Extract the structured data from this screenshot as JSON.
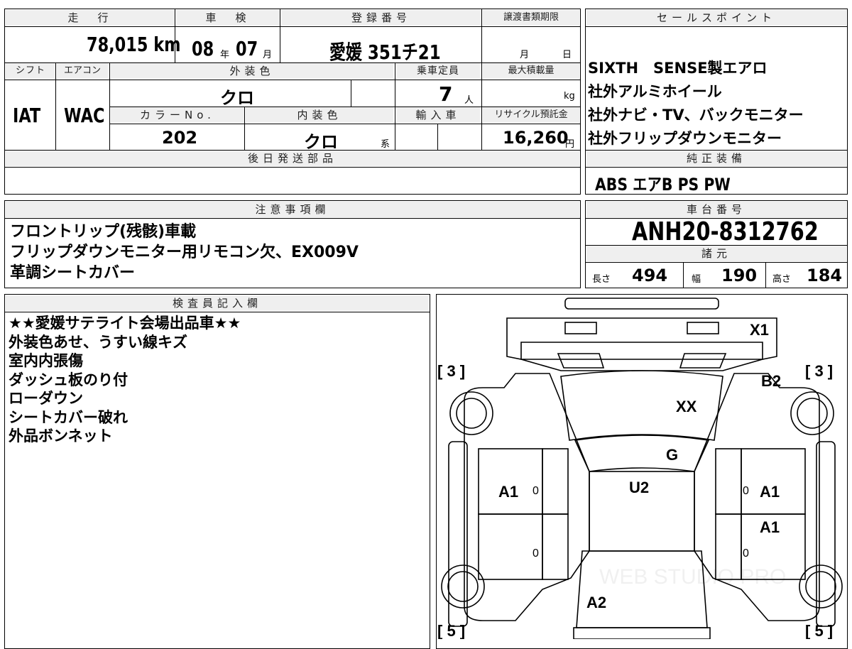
{
  "top": {
    "h_mileage": "走　行",
    "h_inspection": "車　検",
    "h_registration": "登録番号",
    "h_transfer_deadline": "譲渡書類期限",
    "mileage": "78,015 km",
    "insp_year": "08",
    "insp_year_unit": "年",
    "insp_month": "07",
    "insp_month_unit": "月",
    "registration": "愛媛 351チ21",
    "transfer_month": "月",
    "transfer_day": "日",
    "h_shift": "シフト",
    "h_aircon": "エアコン",
    "h_exterior_color": "外装色",
    "h_capacity": "乗車定員",
    "h_max_load": "最大積載量",
    "shift": "IAT",
    "aircon": "WAC",
    "exterior_color": "クロ",
    "capacity": "7",
    "capacity_unit": "人",
    "load_unit": "kg",
    "h_color_no": "カラーNo.",
    "h_interior_color": "内装色",
    "h_import": "輸入車",
    "h_recycle": "リサイクル預託金",
    "color_no": "202",
    "interior_color": "クロ",
    "interior_suffix": "系",
    "recycle_fee": "16,260",
    "recycle_unit": "円",
    "h_later_parts": "後日発送部品"
  },
  "sales": {
    "header": "セールスポイント",
    "points": [
      "SIXTH　SENSE製エアロ",
      "社外アルミホイール",
      "社外ナビ・TV、バックモニター",
      "社外フリップダウンモニター"
    ],
    "h_equipment": "純正装備",
    "equipment": "ABS エアB PS PW"
  },
  "notes": {
    "header": "注意事項欄",
    "lines": [
      "フロントリップ(残骸)車載",
      "フリップダウンモニター用リモコン欠、EX009V",
      "革調シートカバー"
    ]
  },
  "chassis": {
    "header": "車台番号",
    "number": "ANH20-8312762",
    "h_specs": "諸元",
    "length_label": "長さ",
    "length": "494",
    "width_label": "幅",
    "width": "190",
    "height_label": "高さ",
    "height": "184"
  },
  "inspector": {
    "header": "検査員記入欄",
    "lines": [
      "★★愛媛サテライト会場出品車★★",
      "外装色あせ、うすい線キズ",
      "室内内張傷",
      "ダッシュ板のり付",
      "ローダウン",
      "シートカバー破れ",
      "外品ボンネット"
    ]
  },
  "diagram": {
    "tire_fl": "[ 3 ]",
    "tire_fr": "[ 3 ]",
    "tire_rl": "[ 5 ]",
    "tire_rr": "[ 5 ]",
    "mark_x1": "X1",
    "mark_b2": "B2",
    "mark_xx": "XX",
    "mark_g": "G",
    "mark_u2": "U2",
    "mark_a1_left": "A1",
    "mark_a1_right_front": "A1",
    "mark_a1_right_rear": "A1",
    "mark_a2": "A2",
    "zero": "0",
    "watermark": "WEB STUDIO PRO"
  }
}
